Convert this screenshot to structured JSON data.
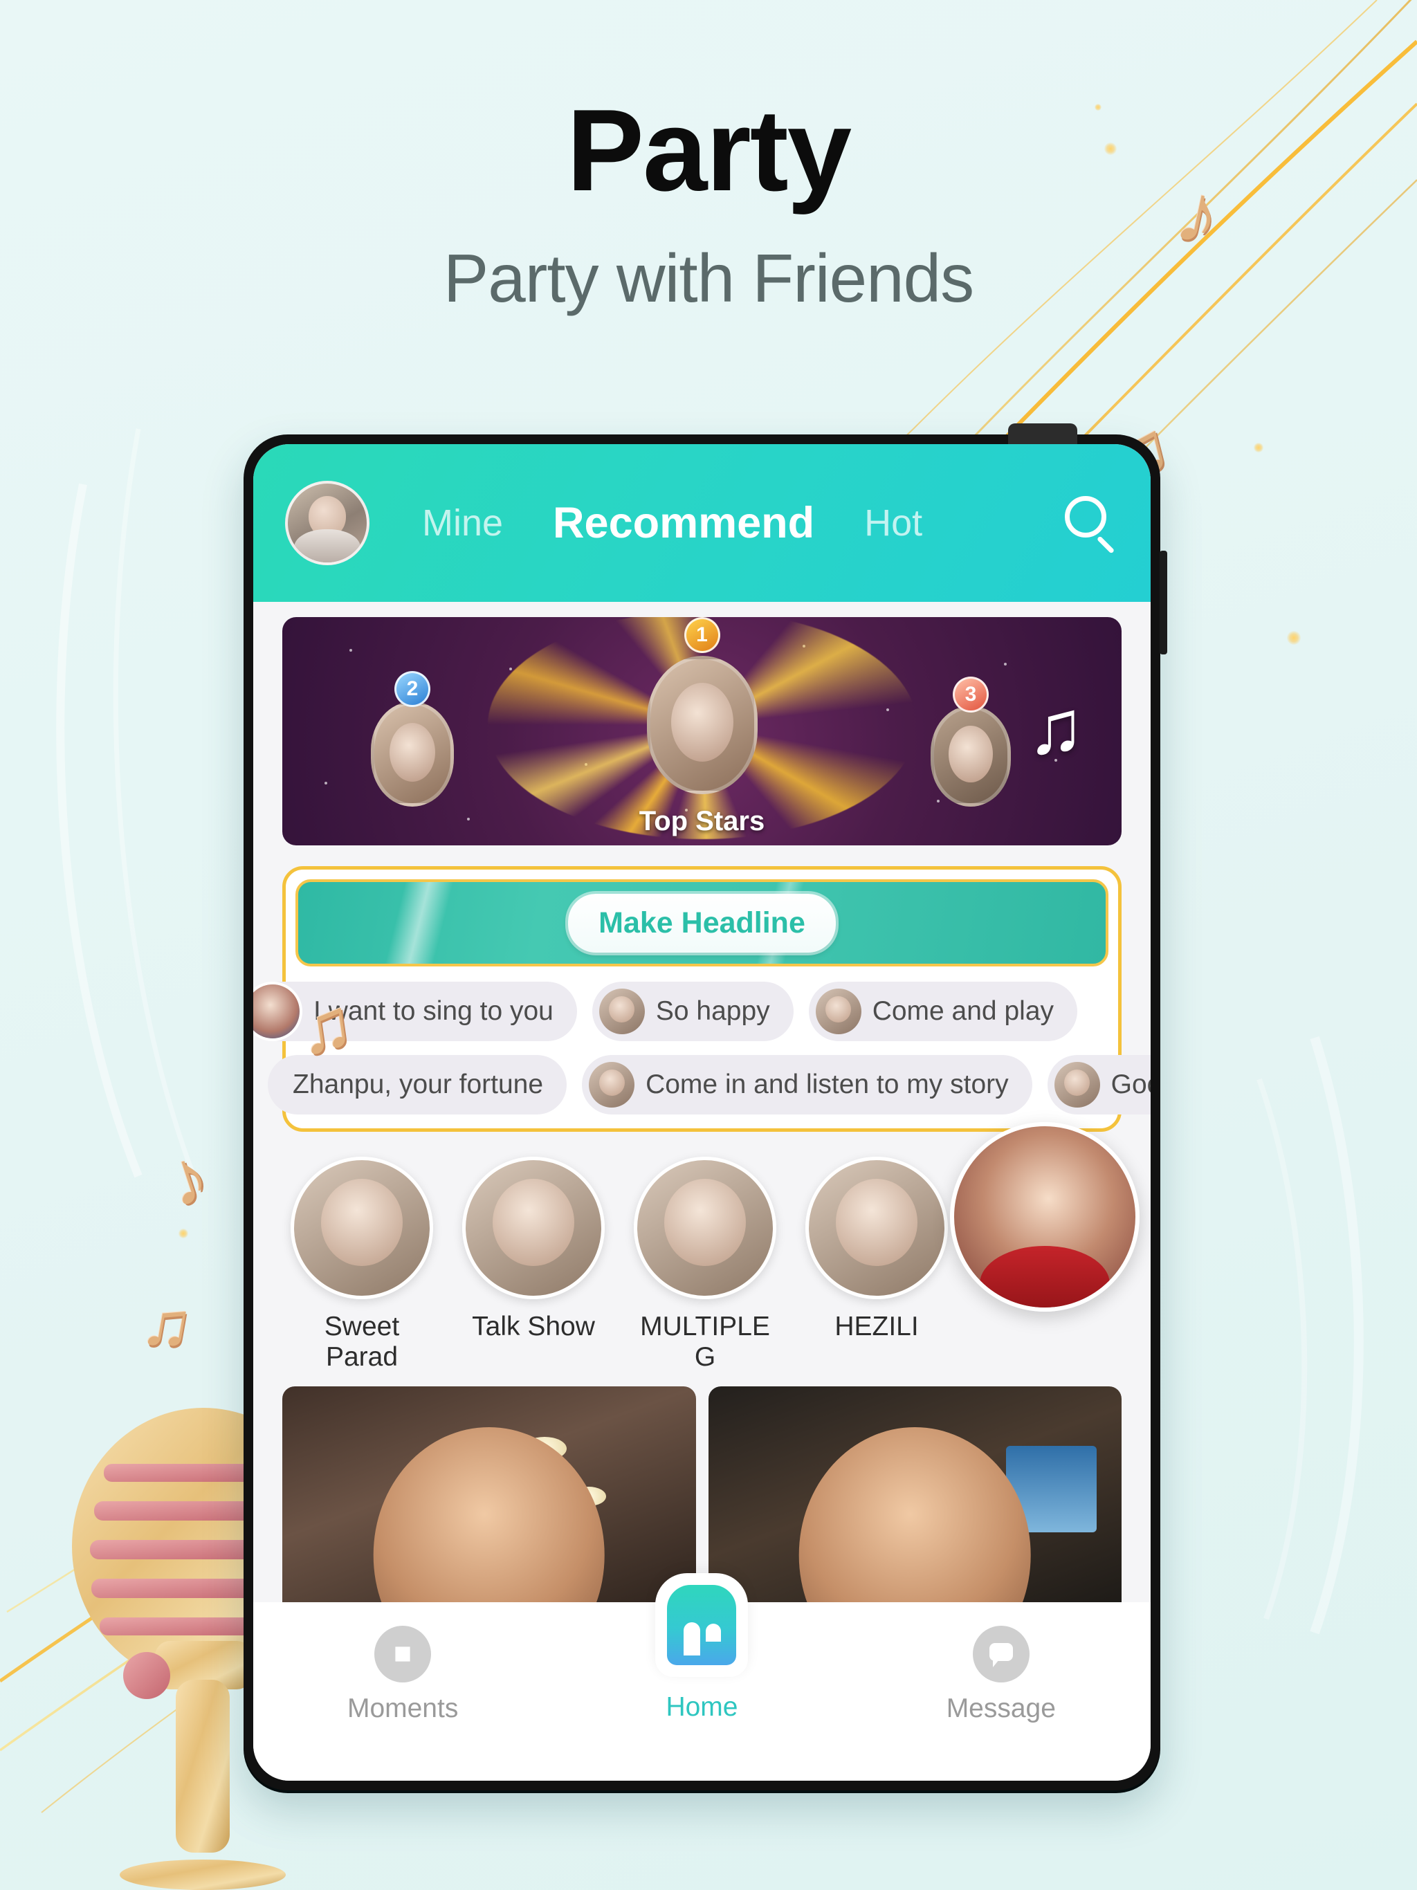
{
  "hero": {
    "title": "Party",
    "subtitle": "Party with Friends"
  },
  "colors": {
    "background": "#e6f6f5",
    "accent_teal": "#2ec6c0",
    "header_gradient_start": "#2ad9b8",
    "header_gradient_end": "#24cfd2",
    "gold": "#f4c23c",
    "banner_purple": "#4b1c49",
    "inactive_gray": "#9a9a9a"
  },
  "app": {
    "header": {
      "avatar_name": "user-avatar",
      "tabs": [
        {
          "label": "Mine",
          "active": false
        },
        {
          "label": "Recommend",
          "active": true
        },
        {
          "label": "Hot",
          "active": false
        }
      ],
      "search_icon": "search-icon"
    },
    "stars_banner": {
      "caption": "Top Stars",
      "ranks": [
        {
          "position": "2",
          "name": "rank-two-star"
        },
        {
          "position": "1",
          "name": "rank-one-star"
        },
        {
          "position": "3",
          "name": "rank-three-star"
        }
      ],
      "decor_icon": "music-note-icon"
    },
    "headline": {
      "button_label": "Make Headline",
      "bubbles_row1": [
        {
          "text": "I want to sing to you"
        },
        {
          "text": "So happy"
        },
        {
          "text": "Come and play"
        }
      ],
      "bubbles_row2": [
        {
          "text": "Zhanpu, your fortune"
        },
        {
          "text": "Come in and listen to my story"
        },
        {
          "text": "Good time"
        }
      ]
    },
    "categories": [
      {
        "label": "Sweet Parad"
      },
      {
        "label": "Talk Show"
      },
      {
        "label": "MULTIPLE G"
      },
      {
        "label": "HEZILI"
      }
    ],
    "featured_avatar": "featured-host-avatar",
    "videos": [
      {
        "name": "video-thumbnail-left"
      },
      {
        "name": "video-thumbnail-right"
      }
    ],
    "bottom_nav": [
      {
        "label": "Moments",
        "icon": "compass-icon",
        "active": false
      },
      {
        "label": "Home",
        "icon": "home-icon",
        "active": true
      },
      {
        "label": "Message",
        "icon": "chat-bubble-icon",
        "active": false
      }
    ]
  },
  "decorations": {
    "microphone": "retro-microphone-icon",
    "notes": [
      "music-note-icon",
      "music-note-icon",
      "music-note-icon",
      "music-note-icon",
      "music-note-icon"
    ]
  }
}
